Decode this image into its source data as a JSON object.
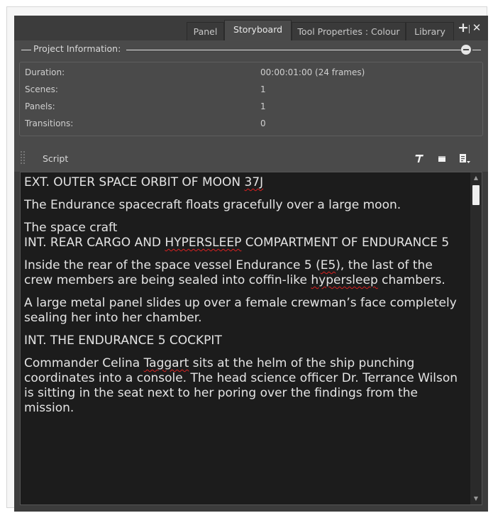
{
  "tabs": [
    {
      "label": "Panel",
      "active": false
    },
    {
      "label": "Storyboard",
      "active": true
    },
    {
      "label": "Tool Properties : Colour",
      "active": false
    },
    {
      "label": "Library",
      "active": false
    }
  ],
  "project_info": {
    "title": "Project Information:",
    "rows": [
      {
        "label": "Duration:",
        "value": "00:00:01:00  (24 frames)"
      },
      {
        "label": "Scenes:",
        "value": "1"
      },
      {
        "label": "Panels:",
        "value": "1"
      },
      {
        "label": "Transitions:",
        "value": "0"
      }
    ]
  },
  "script": {
    "label": "Script",
    "toolbar_icons": [
      "text-format-icon",
      "window-icon",
      "script-menu-icon"
    ],
    "paragraphs": [
      [
        "EXT. OUTER SPACE ORBIT OF MOON ",
        {
          "s": "37J"
        }
      ],
      [
        "The Endurance spacecraft floats gracefully over a large moon."
      ],
      [
        "The space craft\nINT. REAR CARGO AND ",
        {
          "s": "HYPERSLEEP"
        },
        " COMPARTMENT OF ENDURANCE 5"
      ],
      [
        "Inside the rear of the space vessel Endurance 5 (",
        {
          "s": "E5"
        },
        "), the last of the crew members are being sealed into coffin-like ",
        {
          "s": "hypersleep"
        },
        " chambers."
      ],
      [
        "A large metal panel slides up over a female crewman’s face completely sealing her into her chamber."
      ],
      [
        "INT. THE ENDURANCE 5 COCKPIT"
      ],
      [
        "Commander Celina ",
        {
          "s": "Taggart"
        },
        " sits at the helm of the ship punching coordinates into a console. The head science officer Dr. Terrance Wilson is sitting in the seat next to her poring over the findings from the mission."
      ]
    ]
  },
  "colors": {
    "panel_bg": "#3c3c3c",
    "section_bg": "#4a4a4a",
    "script_bg": "#1c1c1c",
    "spellcheck_underline": "#d92020"
  }
}
